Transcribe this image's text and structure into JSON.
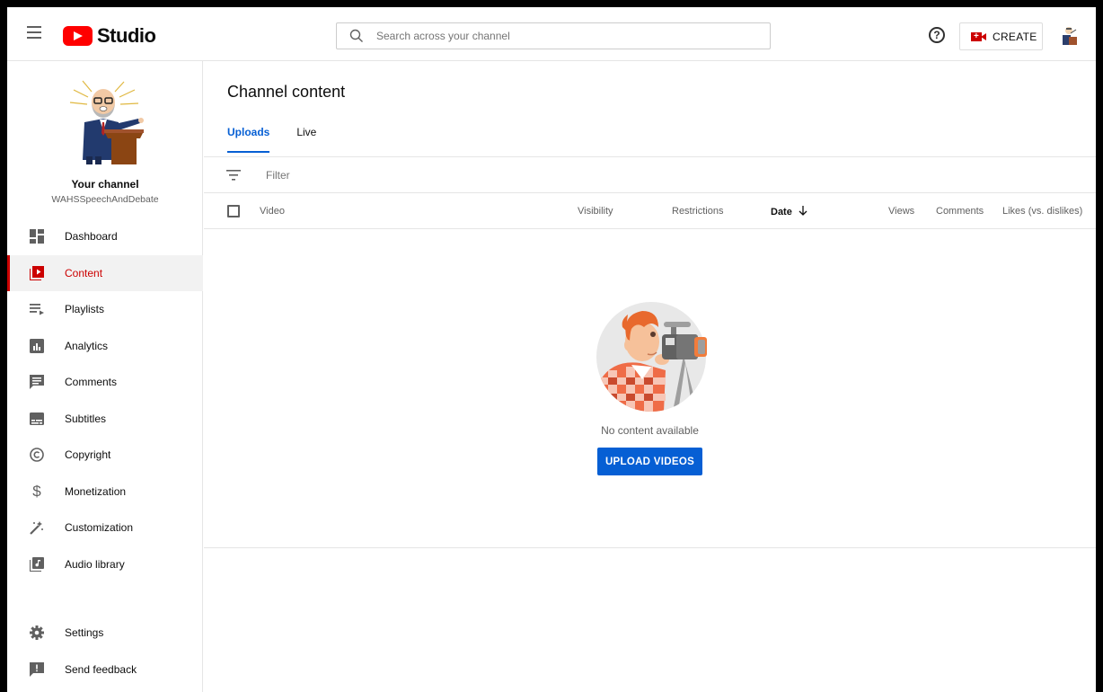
{
  "app": {
    "logo_text": "Studio",
    "search_placeholder": "Search across your channel",
    "create_label": "CREATE"
  },
  "channel": {
    "title": "Your channel",
    "handle": "WAHSSpeechAndDebate"
  },
  "sidebar": {
    "items": [
      {
        "label": "Dashboard",
        "icon": "dashboard-icon"
      },
      {
        "label": "Content",
        "icon": "content-icon",
        "active": true
      },
      {
        "label": "Playlists",
        "icon": "playlists-icon"
      },
      {
        "label": "Analytics",
        "icon": "analytics-icon"
      },
      {
        "label": "Comments",
        "icon": "comments-icon"
      },
      {
        "label": "Subtitles",
        "icon": "subtitles-icon"
      },
      {
        "label": "Copyright",
        "icon": "copyright-icon"
      },
      {
        "label": "Monetization",
        "icon": "monetization-icon"
      },
      {
        "label": "Customization",
        "icon": "customization-icon"
      },
      {
        "label": "Audio library",
        "icon": "audio-library-icon"
      }
    ],
    "bottom_items": [
      {
        "label": "Settings",
        "icon": "settings-icon"
      },
      {
        "label": "Send feedback",
        "icon": "feedback-icon"
      }
    ]
  },
  "main": {
    "title": "Channel content",
    "tabs": [
      {
        "label": "Uploads",
        "active": true
      },
      {
        "label": "Live"
      }
    ],
    "filter_placeholder": "Filter",
    "columns": {
      "video": "Video",
      "visibility": "Visibility",
      "restrictions": "Restrictions",
      "date": "Date",
      "views": "Views",
      "comments": "Comments",
      "likes": "Likes (vs. dislikes)"
    },
    "empty_text": "No content available",
    "upload_label": "UPLOAD VIDEOS"
  },
  "colors": {
    "accent_red": "#cc0000",
    "brand_red": "#ff0000",
    "link_blue": "#065fd4"
  }
}
